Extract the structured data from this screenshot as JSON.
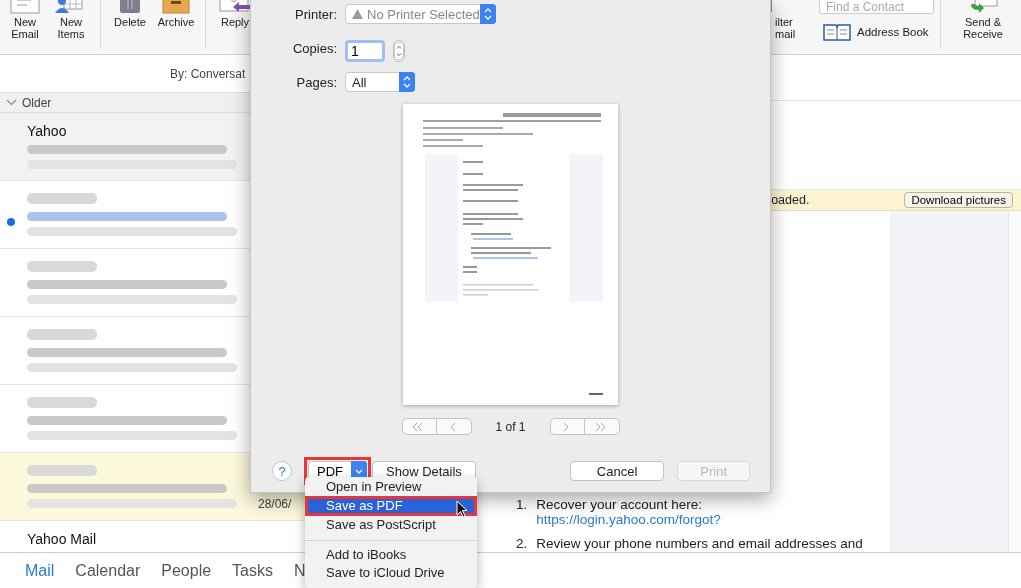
{
  "toolbar": {
    "left": [
      {
        "kind": "new-email",
        "label": "New Email"
      },
      {
        "kind": "new-items",
        "label": "New Items"
      },
      {
        "kind": "delete",
        "label": "Delete"
      },
      {
        "kind": "archive",
        "label": "Archive"
      },
      {
        "kind": "reply",
        "label": "Reply"
      }
    ],
    "filter": {
      "label": "ilter mail"
    },
    "contact_search": {
      "placeholder": "Find a Contact"
    },
    "address_book": {
      "label": "Address Book"
    },
    "send_receive": {
      "label": "Send & Receive"
    }
  },
  "list": {
    "sort_label": "By: Conversat",
    "group": "Older",
    "items": [
      {
        "sender": "Yahoo",
        "selected": true,
        "unread": false,
        "flagged": false
      },
      {
        "selected": false,
        "unread": true,
        "flagged": false
      },
      {
        "selected": false,
        "unread": false,
        "flagged": false
      },
      {
        "selected": false,
        "unread": false,
        "flagged": false
      },
      {
        "selected": false,
        "unread": false,
        "flagged": false
      },
      {
        "date": "28/06/",
        "selected": false,
        "unread": false,
        "flagged": true
      },
      {
        "sender": "Yahoo Mail",
        "selected": false,
        "unread": false,
        "flagged": false
      }
    ]
  },
  "reading_pane": {
    "banner": {
      "text": "oaded.",
      "button": "Download pictures"
    },
    "steps": [
      {
        "number": "1.",
        "text": "Recover your account here:",
        "link": "https://login.yahoo.com/forgot?"
      },
      {
        "number": "2.",
        "text": "Review your phone numbers and email addresses and"
      }
    ]
  },
  "nav": [
    {
      "label": "Mail",
      "selected": true
    },
    {
      "label": "Calendar",
      "selected": false
    },
    {
      "label": "People",
      "selected": false
    },
    {
      "label": "Tasks",
      "selected": false
    },
    {
      "label": "N",
      "selected": false
    }
  ],
  "print_dialog": {
    "printer": {
      "label": "Printer:",
      "value": "No Printer Selected"
    },
    "copies": {
      "label": "Copies:",
      "value": "1"
    },
    "pages": {
      "label": "Pages:",
      "value": "All"
    },
    "page_indicator": "1 of 1",
    "help": "?",
    "pdf": {
      "label": "PDF",
      "highlighted": true
    },
    "buttons": [
      {
        "kind": "details",
        "label": "Show Details",
        "disabled": false
      },
      {
        "kind": "cancel",
        "label": "Cancel",
        "disabled": false
      },
      {
        "kind": "print",
        "label": "Print",
        "disabled": true
      }
    ],
    "pdf_menu": [
      [
        {
          "label": "Open in Preview",
          "selected": false,
          "highlighted": false
        },
        {
          "label": "Save as PDF",
          "selected": true,
          "highlighted": true
        },
        {
          "label": "Save as PostScript",
          "selected": false,
          "highlighted": false
        }
      ],
      [
        {
          "label": "Add to iBooks",
          "selected": false,
          "highlighted": false
        },
        {
          "label": "Save to iCloud Drive",
          "selected": false,
          "highlighted": false
        }
      ]
    ]
  }
}
